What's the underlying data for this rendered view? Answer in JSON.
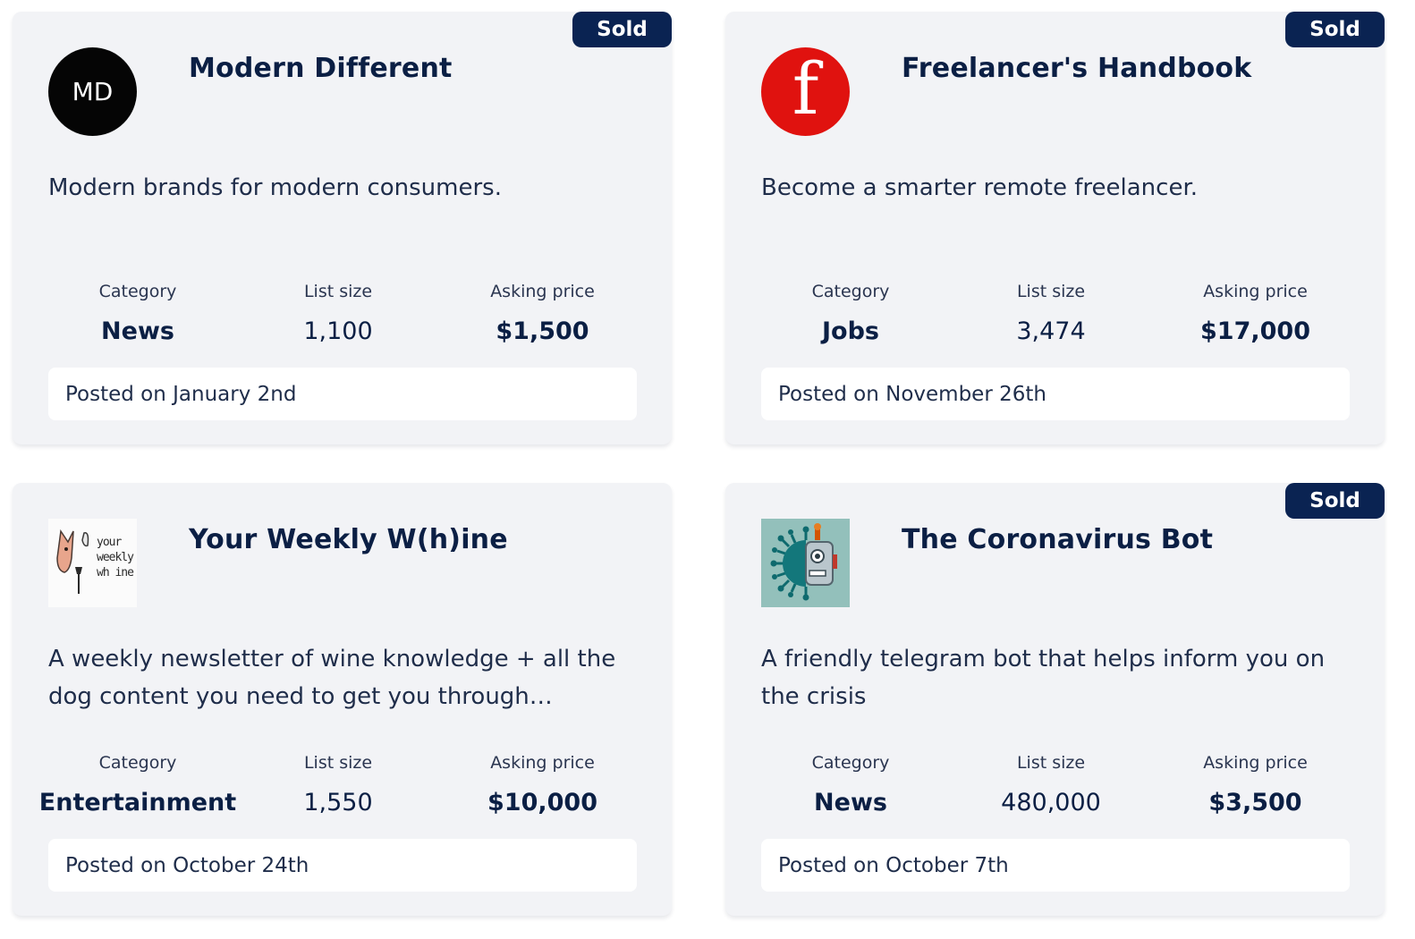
{
  "listings": [
    {
      "badge": "Sold",
      "logo": {
        "icon": "md-monogram-logo",
        "text": "MD",
        "bg": "#050505"
      },
      "title": "Modern Different",
      "description": "Modern brands for modern consumers.",
      "category_label": "Category",
      "category": "News",
      "list_size_label": "List size",
      "list_size": "1,100",
      "price_label": "Asking price",
      "price": "$1,500",
      "posted": "Posted on January 2nd"
    },
    {
      "badge": "Sold",
      "logo": {
        "icon": "f-letter-logo",
        "text": "f",
        "bg": "#e0120f"
      },
      "title": "Freelancer's Handbook",
      "description": "Become a smarter remote freelancer.",
      "category_label": "Category",
      "category": "Jobs",
      "list_size_label": "List size",
      "list_size": "3,474",
      "price_label": "Asking price",
      "price": "$17,000",
      "posted": "Posted on November 26th"
    },
    {
      "badge": "",
      "logo": {
        "icon": "dog-wine-logo",
        "text": "your weekly wh ine"
      },
      "title": "Your Weekly W(h)ine",
      "description": "A weekly newsletter of wine knowledge + all the dog content you need to get you through…",
      "category_label": "Category",
      "category": "Entertainment",
      "list_size_label": "List size",
      "list_size": "1,550",
      "price_label": "Asking price",
      "price": "$10,000",
      "posted": "Posted on October 24th"
    },
    {
      "badge": "Sold",
      "logo": {
        "icon": "virus-robot-logo",
        "bg": "#93c0bb"
      },
      "title": "The Coronavirus Bot",
      "description": "A friendly telegram bot that helps inform you on the crisis",
      "category_label": "Category",
      "category": "News",
      "list_size_label": "List size",
      "list_size": "480,000",
      "price_label": "Asking price",
      "price": "$3,500",
      "posted": "Posted on October 7th"
    }
  ]
}
